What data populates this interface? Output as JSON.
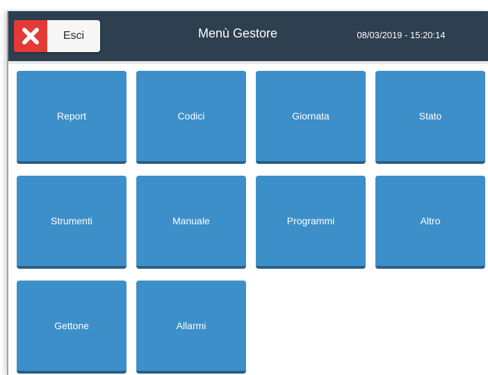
{
  "header": {
    "exit_label": "Esci",
    "title": "Menù Gestore",
    "datetime": "08/03/2019 - 15:20:14"
  },
  "tiles": [
    {
      "label": "Report"
    },
    {
      "label": "Codici"
    },
    {
      "label": "Giornata"
    },
    {
      "label": "Stato"
    },
    {
      "label": "Strumenti"
    },
    {
      "label": "Manuale"
    },
    {
      "label": "Programmi"
    },
    {
      "label": "Altro"
    },
    {
      "label": "Gettone"
    },
    {
      "label": "Allarmi"
    }
  ],
  "colors": {
    "header_bg": "#2e3f4f",
    "tile_bg": "#3d8fc9",
    "exit_icon_bg": "#e53935"
  },
  "icons": {
    "exit": "close-icon"
  }
}
